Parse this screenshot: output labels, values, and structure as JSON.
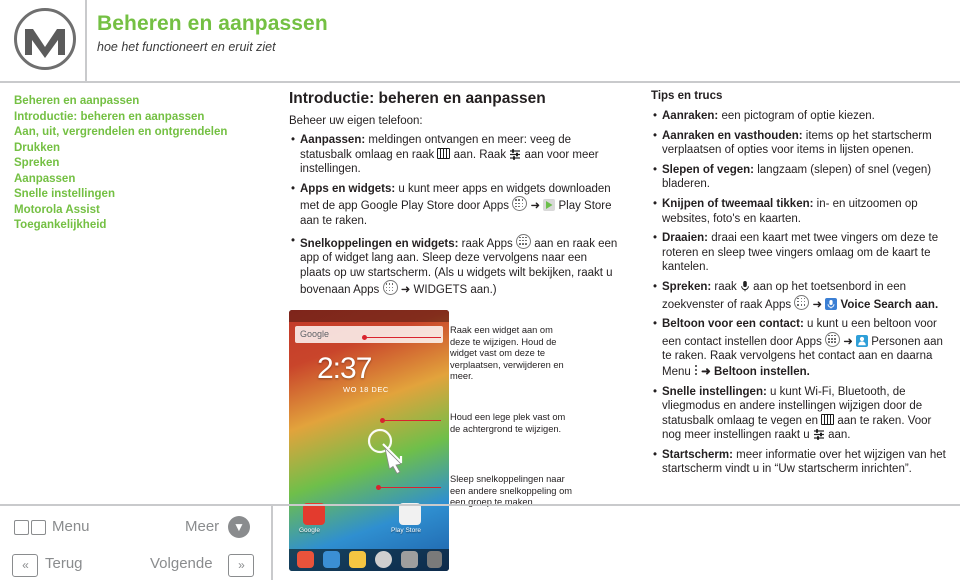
{
  "header": {
    "title": "Beheren en aanpassen",
    "subtitle": "hoe het functioneert en eruit ziet",
    "logo_icon": "motorola-m-logo-icon"
  },
  "nav": {
    "items": [
      "Beheren en aanpassen",
      "Introductie: beheren en aanpassen",
      "Aan, uit, vergrendelen en ontgrendelen",
      "Drukken",
      "Spreken",
      "Aanpassen",
      "Snelle instellingen",
      "Motorola Assist",
      "Toegankelijkheid"
    ]
  },
  "main": {
    "title": "Introductie: beheren en aanpassen",
    "lead": "Beheer uw eigen telefoon:",
    "bullets": [
      {
        "lead": "Aanpassen:",
        "text": " meldingen ontvangen en meer: veeg de statusbalk omlaag en raak ",
        "text2": " aan. Raak ",
        "text3": " aan voor meer instellingen.",
        "icons": [
          "status-bar-icon",
          "sliders-icon"
        ]
      },
      {
        "lead": "Apps en widgets:",
        "text": " u kunt meer apps en widgets downloaden met de app Google Play Store door Apps ",
        "text2": " ➜ ",
        "text3": " Play Store aan te raken.",
        "icons": [
          "apps-grid-icon",
          "play-store-icon"
        ]
      },
      {
        "lead": "Snelkoppelingen en widgets:",
        "text": " raak Apps ",
        "text2": " aan en raak een app of widget lang aan. Sleep deze vervolgens naar een plaats op uw startscherm. (Als u widgets wilt bekijken, raakt u bovenaan Apps ",
        "text3": " ➜ WIDGETS aan.)",
        "icons": [
          "apps-grid-icon",
          "apps-grid-icon"
        ]
      }
    ]
  },
  "phone": {
    "search_hint": "Google",
    "clock_time": "2:37",
    "clock_date": "WO 18 DEC",
    "dock_labels": [
      "Google",
      "Play Store"
    ],
    "callouts": [
      "Raak een widget aan om deze te wijzigen. Houd de widget vast om deze te verplaatsen, verwijderen en meer.",
      "Houd een lege plek vast om de achtergrond te wijzigen.",
      "Sleep snelkoppelingen naar een andere snelkoppeling om een groep te maken."
    ]
  },
  "tips": {
    "title": "Tips en trucs",
    "bullets": [
      {
        "lead": "Aanraken:",
        "text": " een pictogram of optie kiezen."
      },
      {
        "lead": "Aanraken en vasthouden:",
        "text": " items op het startscherm verplaatsen of opties voor items in lijsten openen."
      },
      {
        "lead": "Slepen of vegen:",
        "text": " langzaam (slepen) of snel (vegen) bladeren."
      },
      {
        "lead": "Knijpen of tweemaal tikken:",
        "text": " in- en uitzoomen op websites, foto's en kaarten."
      },
      {
        "lead": "Draaien:",
        "text": " draai een kaart met twee vingers om deze te roteren en sleep twee vingers omlaag om de kaart te kantelen."
      },
      {
        "lead": "Spreken:",
        "text": " raak ",
        "text2": " aan op het toetsenbord in een zoekvenster of raak Apps ",
        "text3": " ➜ ",
        "text4": " Voice Search aan.",
        "icons": [
          "mic-icon",
          "apps-grid-icon",
          "voice-search-icon"
        ]
      },
      {
        "lead": "Beltoon voor een contact:",
        "text": " u kunt u een beltoon voor een contact instellen door Apps ",
        "text2": " ➜ ",
        "text3": " Personen aan te raken. Raak vervolgens het contact aan en daarna Menu ",
        "text4": " ➜ Beltoon instellen.",
        "icons": [
          "apps-grid-icon",
          "people-icon",
          "menu-dots-icon"
        ]
      },
      {
        "lead": "Snelle instellingen:",
        "text": " u kunt Wi-Fi, Bluetooth, de vliegmodus en andere instellingen wijzigen door de statusbalk omlaag te vegen en ",
        "text2": " aan te raken. Voor nog meer instellingen raakt u ",
        "text3": " aan.",
        "icons": [
          "status-bar-icon",
          "sliders-icon"
        ]
      },
      {
        "lead": "Startscherm:",
        "text": " meer informatie over het wijzigen van het startscherm vindt u in “Uw startscherm inrichten”."
      }
    ]
  },
  "footer": {
    "menu_label": "Menu",
    "back_label": "Terug",
    "more_label": "Meer",
    "next_label": "Volgende",
    "more_icon": "chevron-down-circle-icon",
    "back_icon": "chevron-left-left-icon",
    "next_icon": "chevron-right-right-icon",
    "menu_icon": "menu-grid-icon"
  },
  "colors": {
    "accent_green": "#74c043",
    "rule_gray": "#c9cacc",
    "callout_red": "#d9232e",
    "footer_gray": "#8a8c8e"
  }
}
